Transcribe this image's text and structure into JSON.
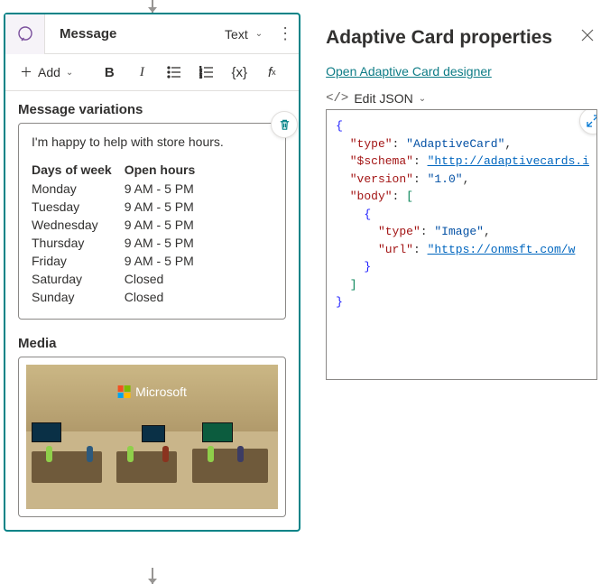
{
  "left": {
    "topConnector": true,
    "header": {
      "title": "Message",
      "typeLabel": "Text"
    },
    "toolbar": {
      "addLabel": "Add"
    },
    "variations": {
      "title": "Message variations",
      "introText": "I'm happy to help with store hours.",
      "columns": [
        "Days of week",
        "Open hours"
      ],
      "rows": [
        [
          "Monday",
          "9 AM - 5 PM"
        ],
        [
          "Tuesday",
          "9 AM - 5 PM"
        ],
        [
          "Wednesday",
          "9 AM - 5 PM"
        ],
        [
          "Thursday",
          "9 AM - 5 PM"
        ],
        [
          "Friday",
          "9 AM - 5 PM"
        ],
        [
          "Saturday",
          "Closed"
        ],
        [
          "Sunday",
          "Closed"
        ]
      ]
    },
    "media": {
      "title": "Media",
      "logoText": "Microsoft"
    }
  },
  "right": {
    "title": "Adaptive Card properties",
    "designerLink": "Open Adaptive Card designer",
    "editJsonLabel": "Edit JSON",
    "json": {
      "l1": "{",
      "l2a": "\"type\"",
      "l2b": ": ",
      "l2c": "\"AdaptiveCard\"",
      "l2d": ",",
      "l3a": "\"$schema\"",
      "l3b": ": ",
      "l3c": "\"http://adaptivecards.i",
      "l4a": "\"version\"",
      "l4b": ": ",
      "l4c": "\"1.0\"",
      "l4d": ",",
      "l5a": "\"body\"",
      "l5b": ": ",
      "l5c": "[",
      "l6": "{",
      "l7a": "\"type\"",
      "l7b": ": ",
      "l7c": "\"Image\"",
      "l7d": ",",
      "l8a": "\"url\"",
      "l8b": ": ",
      "l8c": "\"https://onmsft.com/w",
      "l9": "}",
      "l10": "]",
      "l11": "}"
    }
  }
}
